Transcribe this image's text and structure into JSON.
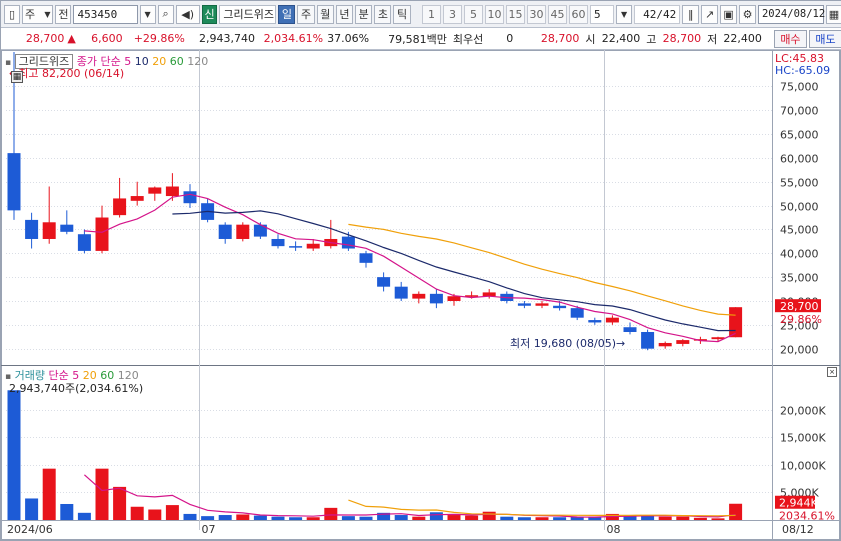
{
  "toolbar": {
    "market": "주",
    "prefix": "전",
    "code": "453450",
    "badge": "신",
    "name": "그리드위즈",
    "periods": [
      "일",
      "주",
      "월",
      "년",
      "분",
      "초",
      "틱"
    ],
    "active_period": "일",
    "numbers": [
      "1",
      "3",
      "5",
      "10",
      "15",
      "30",
      "45",
      "60"
    ],
    "interval": "5",
    "page_count": "42/42",
    "date": "2024/08/12"
  },
  "info": {
    "price": "28,700",
    "change": "6,600",
    "change_pct": "+29.86%",
    "volume": "2,943,740",
    "volume_pct": "2,034.61%",
    "turnover_pct": "37.06%",
    "amount": "79,581백만",
    "preferred_label": "최우선",
    "preferred_value": "0",
    "last": "28,700",
    "open_label": "시",
    "open": "22,400",
    "high_label": "고",
    "high": "28,700",
    "low_label": "저",
    "low": "22,400",
    "buy_label": "매수",
    "sell_label": "매도"
  },
  "price_panel": {
    "legend_title": "그리드위즈",
    "legend_line": "종가 단순",
    "ma_periods": [
      "5",
      "10",
      "20",
      "60",
      "120"
    ],
    "max_note": "최고 82,200 (06/14)",
    "min_note": "최저 19,680 (08/05)",
    "lc": "LC:45.83",
    "hc": "HC:-65.09",
    "current_price_tag": "28,700",
    "current_pct_tag": "29.86%"
  },
  "volume_panel": {
    "legend_title": "거래량",
    "legend_line": "단순",
    "ma_periods": [
      "5",
      "20",
      "60",
      "120"
    ],
    "summary": "2,943,740주(2,034.61%)",
    "current_volume_tag": "2,944K",
    "current_pct_tag": "2034.61%"
  },
  "x_axis": {
    "labels": [
      {
        "text": "2024/06",
        "index": 0
      },
      {
        "text": "07",
        "index": 11
      },
      {
        "text": "08",
        "index": 34
      }
    ],
    "right_label": "08/12"
  },
  "colors": {
    "up": "#e8131b",
    "down": "#1d5bd6",
    "ma5": "#d4148a",
    "ma10": "#1c2a6b",
    "ma20": "#f0a00a",
    "ma60": "#2a9b3a",
    "ma120": "#888888",
    "vol_ma5": "#d4148a",
    "vol_ma20": "#f0a00a"
  },
  "chart_data": {
    "type": "candlestick",
    "price_axis": {
      "ticks": [
        20000,
        25000,
        30000,
        35000,
        40000,
        45000,
        50000,
        55000,
        60000,
        65000,
        70000,
        75000
      ],
      "range": [
        17000,
        82200
      ]
    },
    "volume_axis": {
      "ticks_k": [
        5000,
        10000,
        15000,
        20000
      ],
      "range_k": [
        0,
        25000
      ],
      "tick_suffix": "K"
    },
    "candles": [
      {
        "o": 61000,
        "h": 82200,
        "l": 47000,
        "c": 49000,
        "v": 23500
      },
      {
        "o": 47000,
        "h": 48500,
        "l": 41000,
        "c": 43000,
        "v": 3900
      },
      {
        "o": 43000,
        "h": 54000,
        "l": 42000,
        "c": 46500,
        "v": 9300
      },
      {
        "o": 46000,
        "h": 49000,
        "l": 44000,
        "c": 44500,
        "v": 2900
      },
      {
        "o": 44000,
        "h": 45000,
        "l": 40000,
        "c": 40500,
        "v": 1300
      },
      {
        "o": 40500,
        "h": 50000,
        "l": 40000,
        "c": 47500,
        "v": 9300
      },
      {
        "o": 48000,
        "h": 55800,
        "l": 47500,
        "c": 51500,
        "v": 6000
      },
      {
        "o": 51000,
        "h": 55000,
        "l": 50000,
        "c": 52000,
        "v": 2400
      },
      {
        "o": 52500,
        "h": 54000,
        "l": 51000,
        "c": 53800,
        "v": 1900
      },
      {
        "o": 52000,
        "h": 56800,
        "l": 51000,
        "c": 54000,
        "v": 2700
      },
      {
        "o": 53000,
        "h": 54500,
        "l": 49500,
        "c": 50500,
        "v": 1100
      },
      {
        "o": 50500,
        "h": 51500,
        "l": 46500,
        "c": 47000,
        "v": 700
      },
      {
        "o": 46000,
        "h": 46500,
        "l": 42000,
        "c": 43000,
        "v": 900
      },
      {
        "o": 43000,
        "h": 46500,
        "l": 42500,
        "c": 46000,
        "v": 1000
      },
      {
        "o": 46000,
        "h": 46500,
        "l": 43000,
        "c": 43500,
        "v": 800
      },
      {
        "o": 43000,
        "h": 44000,
        "l": 41000,
        "c": 41500,
        "v": 600
      },
      {
        "o": 41500,
        "h": 42500,
        "l": 40500,
        "c": 41200,
        "v": 500
      },
      {
        "o": 41000,
        "h": 43000,
        "l": 40500,
        "c": 42000,
        "v": 500
      },
      {
        "o": 41500,
        "h": 47000,
        "l": 41000,
        "c": 43000,
        "v": 2200
      },
      {
        "o": 43500,
        "h": 44500,
        "l": 40500,
        "c": 41000,
        "v": 700
      },
      {
        "o": 40000,
        "h": 40500,
        "l": 37000,
        "c": 38000,
        "v": 600
      },
      {
        "o": 35000,
        "h": 36000,
        "l": 32000,
        "c": 33000,
        "v": 1300
      },
      {
        "o": 33000,
        "h": 34000,
        "l": 30000,
        "c": 30500,
        "v": 900
      },
      {
        "o": 30500,
        "h": 32000,
        "l": 29500,
        "c": 31500,
        "v": 600
      },
      {
        "o": 31500,
        "h": 32500,
        "l": 28500,
        "c": 29500,
        "v": 1400
      },
      {
        "o": 30000,
        "h": 31500,
        "l": 29000,
        "c": 31000,
        "v": 900
      },
      {
        "o": 31000,
        "h": 32000,
        "l": 30500,
        "c": 31200,
        "v": 800
      },
      {
        "o": 31000,
        "h": 32500,
        "l": 30500,
        "c": 31800,
        "v": 1500
      },
      {
        "o": 31500,
        "h": 32000,
        "l": 29500,
        "c": 30000,
        "v": 600
      },
      {
        "o": 29500,
        "h": 30000,
        "l": 28500,
        "c": 29000,
        "v": 500
      },
      {
        "o": 29000,
        "h": 30000,
        "l": 28500,
        "c": 29500,
        "v": 500
      },
      {
        "o": 29000,
        "h": 30000,
        "l": 28000,
        "c": 28500,
        "v": 500
      },
      {
        "o": 28500,
        "h": 29000,
        "l": 26000,
        "c": 26500,
        "v": 600
      },
      {
        "o": 26000,
        "h": 26500,
        "l": 25000,
        "c": 25500,
        "v": 500
      },
      {
        "o": 25500,
        "h": 27000,
        "l": 25000,
        "c": 26500,
        "v": 1100
      },
      {
        "o": 24500,
        "h": 25500,
        "l": 23000,
        "c": 23500,
        "v": 700
      },
      {
        "o": 23500,
        "h": 24000,
        "l": 19680,
        "c": 20000,
        "v": 900
      },
      {
        "o": 20500,
        "h": 21500,
        "l": 20000,
        "c": 21200,
        "v": 600
      },
      {
        "o": 21000,
        "h": 22000,
        "l": 20500,
        "c": 21800,
        "v": 600
      },
      {
        "o": 21800,
        "h": 22500,
        "l": 21000,
        "c": 22000,
        "v": 400
      },
      {
        "o": 22000,
        "h": 22500,
        "l": 21500,
        "c": 22400,
        "v": 300
      },
      {
        "o": 22400,
        "h": 28700,
        "l": 22400,
        "c": 28700,
        "v": 2944
      }
    ]
  }
}
